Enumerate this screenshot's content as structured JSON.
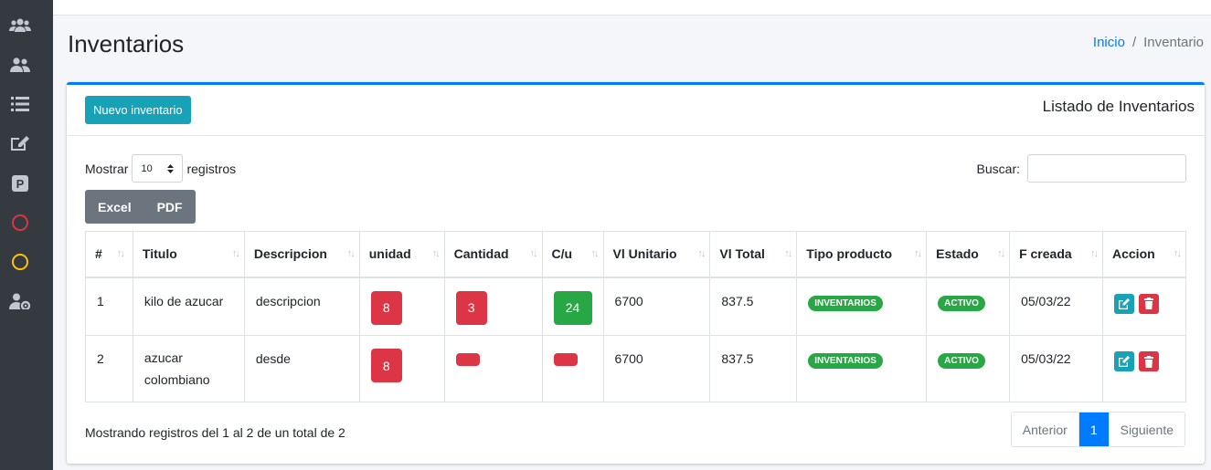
{
  "colors": {
    "sidebar_bg": "#343a40",
    "primary": "#007bff",
    "info": "#17a2b8",
    "danger": "#dc3545",
    "success": "#28a745",
    "secondary": "#6c757d",
    "sidebar_red_circle": "#dc3545",
    "sidebar_yellow_circle": "#ffc107"
  },
  "sidebar": {
    "icons": [
      "users-icon",
      "user-group-icon",
      "list-icon",
      "edit-icon",
      "parking-icon",
      "circle-red-icon",
      "circle-yellow-icon",
      "user-cog-icon"
    ]
  },
  "page": {
    "title": "Inventarios"
  },
  "breadcrumb": {
    "home": "Inicio",
    "separator": "/",
    "current": "Inventario"
  },
  "card": {
    "new_button": "Nuevo inventario",
    "title": "Listado de Inventarios"
  },
  "length_control": {
    "prefix": "Mostrar",
    "value": "10",
    "suffix": "registros"
  },
  "search": {
    "label": "Buscar:",
    "value": ""
  },
  "export": {
    "excel": "Excel",
    "pdf": "PDF"
  },
  "table": {
    "columns": [
      "#",
      "Titulo",
      "Descripcion",
      "unidad",
      "Cantidad",
      "C/u",
      "Vl Unitario",
      "Vl Total",
      "Tipo producto",
      "Estado",
      "F creada",
      "Accion"
    ],
    "sorted_column": "#",
    "rows": [
      {
        "id": "1",
        "titulo": "kilo de azucar",
        "descripcion": "descripcion",
        "unidad": "8",
        "cantidad": "3",
        "cu": "24",
        "vl_unitario": "6700",
        "vl_total": "837.5",
        "tipo": "INVENTARIOS",
        "estado": "ACTIVO",
        "fecha": "05/03/22"
      },
      {
        "id": "2",
        "titulo_line1": "azucar",
        "titulo_line2": "colombiano",
        "descripcion": "desde",
        "unidad": "8",
        "cantidad": "",
        "cu": "",
        "vl_unitario": "6700",
        "vl_total": "837.5",
        "tipo": "INVENTARIOS",
        "estado": "ACTIVO",
        "fecha": "05/03/22"
      }
    ]
  },
  "footer": {
    "info": "Mostrando registros del 1 al 2 de un total de 2",
    "prev": "Anterior",
    "page": "1",
    "next": "Siguiente"
  }
}
